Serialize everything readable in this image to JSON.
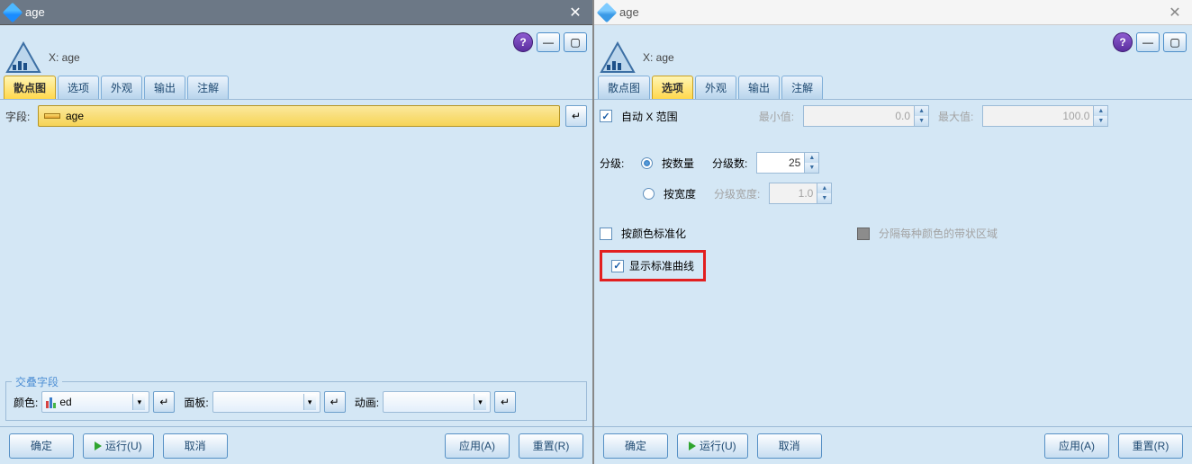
{
  "left": {
    "title": "age",
    "x_label": "X: age",
    "tabs": [
      "散点图",
      "选项",
      "外观",
      "输出",
      "注解"
    ],
    "active_tab": 0,
    "field_label": "字段:",
    "field_value": "age",
    "cross_legend": "交叠字段",
    "color_label": "颜色:",
    "color_value": "ed",
    "panel_label": "面板:",
    "anim_label": "动画:",
    "buttons": {
      "ok": "确定",
      "run": "运行(U)",
      "cancel": "取消",
      "apply": "应用(A)",
      "reset": "重置(R)"
    }
  },
  "right": {
    "title": "age",
    "x_label": "X: age",
    "tabs": [
      "散点图",
      "选项",
      "外观",
      "输出",
      "注解"
    ],
    "active_tab": 1,
    "auto_x_range": "自动 X 范围",
    "min_label": "最小值:",
    "min_value": "0.0",
    "max_label": "最大值:",
    "max_value": "100.0",
    "grade_label": "分级:",
    "by_count": "按数量",
    "by_width": "按宽度",
    "bins_label": "分级数:",
    "bins_value": "25",
    "binwidth_label": "分级宽度:",
    "binwidth_value": "1.0",
    "normalize_by_color": "按颜色标准化",
    "split_strip": "分隔每种颜色的带状区域",
    "show_std_curve": "显示标准曲线",
    "buttons": {
      "ok": "确定",
      "run": "运行(U)",
      "cancel": "取消",
      "apply": "应用(A)",
      "reset": "重置(R)"
    }
  }
}
